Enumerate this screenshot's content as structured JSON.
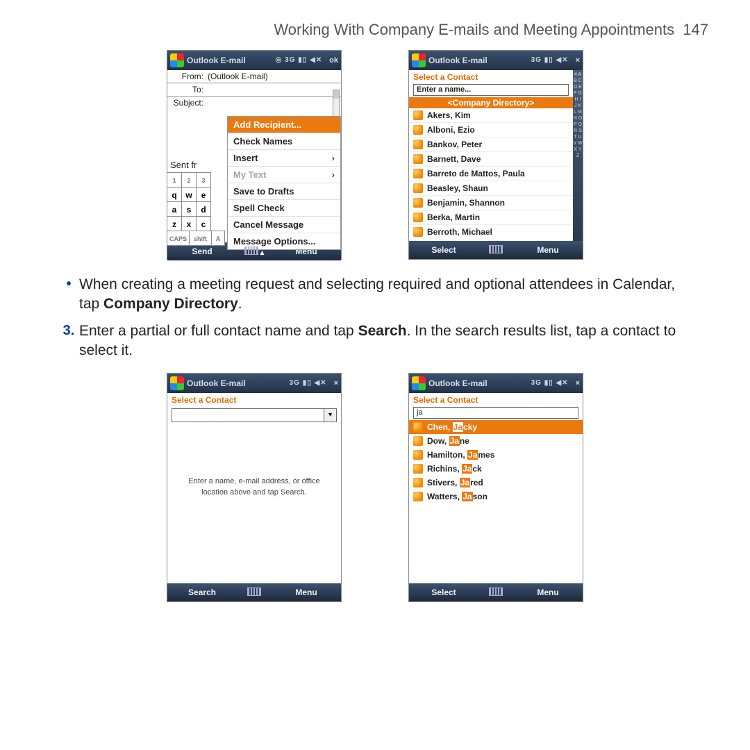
{
  "page": {
    "title": "Working With Company E-mails and Meeting Appointments",
    "number": "147"
  },
  "shot1": {
    "title": "Outlook E-mail",
    "ok": "ok",
    "from_lbl": "From:",
    "from_val": "(Outlook E-mail)",
    "to_lbl": "To:",
    "subject_lbl": "Subject:",
    "sent_partial": "Sent fr",
    "menu": {
      "add": "Add Recipient...",
      "check": "Check Names",
      "insert": "Insert",
      "mytext": "My Text",
      "drafts": "Save to Drafts",
      "spell": "Spell Check",
      "cancel": "Cancel Message",
      "options": "Message Options..."
    },
    "soft_left": "Send",
    "soft_right": "Menu",
    "keys_r1": [
      "1",
      "2",
      "3"
    ],
    "keys_r2": [
      "q",
      "w",
      "e"
    ],
    "keys_r3": [
      "a",
      "s",
      "d"
    ],
    "keys_r4": [
      "z",
      "x",
      "c"
    ],
    "keys_r5a": "CAPS",
    "keys_r5b": "shift",
    "keys_r5c": "A"
  },
  "shot2": {
    "title": "Outlook E-mail",
    "close": "×",
    "select_hdr": "Select a Contact",
    "input_placeholder": "Enter a name...",
    "dir_hdr": "<Company Directory>",
    "contacts": [
      "Akers, Kim",
      "Alboni, Ezio",
      "Bankov, Peter",
      "Barnett, Dave",
      "Barreto de Mattos, Paula",
      "Beasley, Shaun",
      "Benjamin, Shannon",
      "Berka, Martin",
      "Berroth, Michael"
    ],
    "az": "#ABCDEFGHIJKLMNOPQRSTUVWXYZ",
    "soft_left": "Select",
    "soft_right": "Menu"
  },
  "instr1_a": "When creating a meeting request and selecting required and optional attendees in Calendar, tap ",
  "instr1_b": "Company Directory",
  "instr1_c": ".",
  "step3_num": "3.",
  "instr2_a": "Enter a partial or full contact name and tap ",
  "instr2_b": "Search",
  "instr2_c": ". In the search results list, tap a contact to select it.",
  "shot3": {
    "title": "Outlook E-mail",
    "select_hdr": "Select a Contact",
    "hint": "Enter a name, e-mail address, or office location above and tap Search.",
    "soft_left": "Search",
    "soft_right": "Menu"
  },
  "shot4": {
    "title": "Outlook E-mail",
    "select_hdr": "Select a Contact",
    "query": "ja",
    "results": [
      {
        "pre": "Chen, ",
        "hl": "Ja",
        "post": "cky",
        "sel": true
      },
      {
        "pre": "Dow, ",
        "hl": "Ja",
        "post": "ne"
      },
      {
        "pre": "Hamilton, ",
        "hl": "Ja",
        "post": "mes"
      },
      {
        "pre": "Richins, ",
        "hl": "Ja",
        "post": "ck"
      },
      {
        "pre": "Stivers, ",
        "hl": "Ja",
        "post": "red"
      },
      {
        "pre": "Watters, ",
        "hl": "Ja",
        "post": "son"
      }
    ],
    "soft_left": "Select",
    "soft_right": "Menu"
  }
}
